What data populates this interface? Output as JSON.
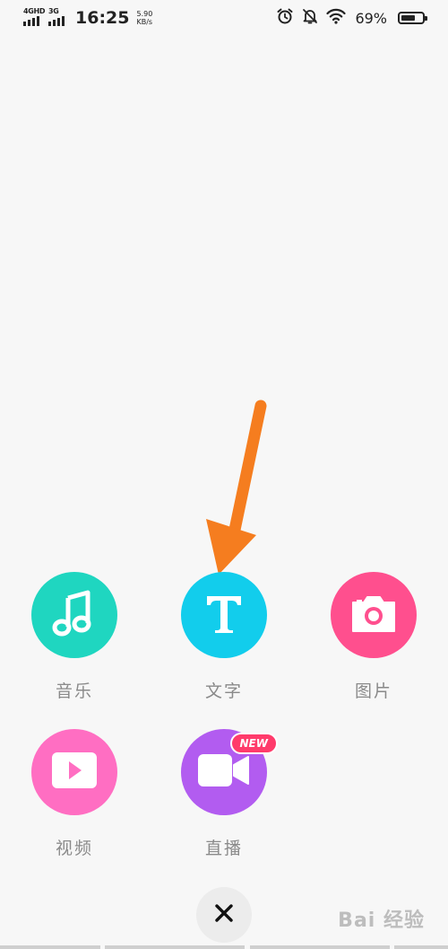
{
  "status_bar": {
    "sim1_network": "4GHD",
    "sim2_network": "3G",
    "time": "16:25",
    "speed_value": "5.90",
    "speed_unit": "KB/s",
    "battery_percent": "69%",
    "battery_level": 0.69
  },
  "actions": [
    {
      "label": "音乐",
      "color": "#1fd6c0",
      "icon": "music-note-icon"
    },
    {
      "label": "文字",
      "color": "#12cdec",
      "icon": "text-t-icon"
    },
    {
      "label": "图片",
      "color": "#ff4f8e",
      "icon": "camera-icon"
    },
    {
      "label": "视频",
      "color": "#ff6ec2",
      "icon": "video-play-icon"
    },
    {
      "label": "直播",
      "color": "#b25cf0",
      "icon": "video-camera-icon",
      "badge": "NEW"
    }
  ],
  "annotation": {
    "arrow_color": "#f57d1f"
  },
  "close": {
    "icon": "close-icon"
  },
  "watermark": "Bai 经验"
}
